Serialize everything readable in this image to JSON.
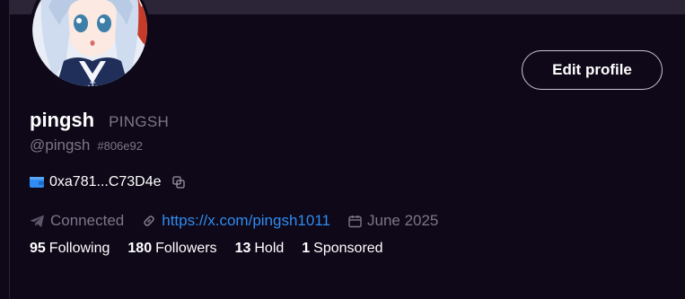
{
  "profile": {
    "display_name": "pingsh",
    "tag_name": "PINGSH",
    "handle": "@pingsh",
    "hexcode": "#806e92",
    "wallet_address": "0xa781...C73D4e",
    "status": "Connected",
    "link": "https://x.com/pingsh1011",
    "joined": "June 2025"
  },
  "actions": {
    "edit_profile_label": "Edit profile"
  },
  "stats": [
    {
      "count": "95",
      "label": "Following"
    },
    {
      "count": "180",
      "label": "Followers"
    },
    {
      "count": "13",
      "label": "Hold"
    },
    {
      "count": "1",
      "label": "Sponsored"
    }
  ],
  "icons": {
    "wallet": "wallet-icon",
    "copy": "copy-icon",
    "telegram": "telegram-icon",
    "link": "link-icon",
    "calendar": "calendar-icon"
  },
  "colors": {
    "background": "#0e0818",
    "muted_text": "#7d7689",
    "link": "#2f8cf0",
    "wallet_icon": "#2f8cf0"
  }
}
